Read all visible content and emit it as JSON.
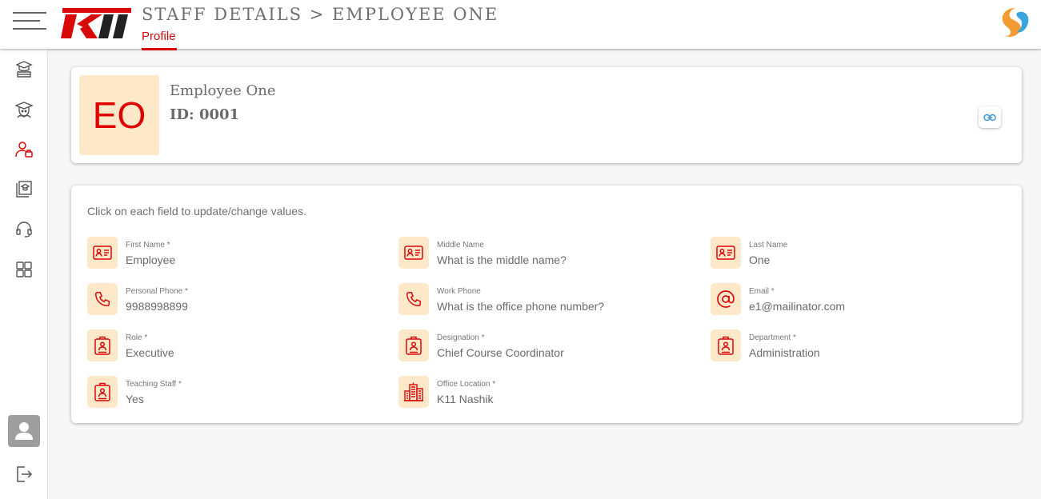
{
  "header": {
    "title": "STAFF DETAILS > EMPLOYEE ONE",
    "tab_label": "Profile",
    "logo_text": "K11",
    "brand_color": "#d90808"
  },
  "sidebar": {
    "items": [
      {
        "icon": "books-icon"
      },
      {
        "icon": "student-icon"
      },
      {
        "icon": "staff-icon",
        "active": true
      },
      {
        "icon": "courses-icon"
      },
      {
        "icon": "support-headset-icon"
      },
      {
        "icon": "dashboard-grid-icon"
      }
    ],
    "bottom": [
      {
        "icon": "user-avatar-icon"
      },
      {
        "icon": "logout-icon"
      }
    ]
  },
  "profile": {
    "initials": "EO",
    "name": "Employee One",
    "id_text": "ID: 0001",
    "action_icon": "link-icon"
  },
  "details": {
    "hint": "Click on each field to update/change values.",
    "fields": [
      {
        "label": "First Name *",
        "value": "Employee",
        "icon": "id-card-icon"
      },
      {
        "label": "Middle Name",
        "value": "What is the middle name?",
        "icon": "id-card-icon"
      },
      {
        "label": "Last Name",
        "value": "One",
        "icon": "id-card-icon"
      },
      {
        "label": "Personal Phone *",
        "value": "9988998899",
        "icon": "phone-icon"
      },
      {
        "label": "Work Phone",
        "value": "What is the office phone number?",
        "icon": "phone-icon"
      },
      {
        "label": "Email *",
        "value": "e1@mailinator.com",
        "icon": "at-sign-icon"
      },
      {
        "label": "Role *",
        "value": "Executive",
        "icon": "badge-icon"
      },
      {
        "label": "Designation *",
        "value": "Chief Course Coordinator",
        "icon": "badge-icon"
      },
      {
        "label": "Department *",
        "value": "Administration",
        "icon": "badge-icon"
      },
      {
        "label": "Teaching Staff *",
        "value": "Yes",
        "icon": "badge-icon"
      },
      {
        "label": "Office Location *",
        "value": "K11 Nashik",
        "icon": "building-icon"
      }
    ]
  }
}
